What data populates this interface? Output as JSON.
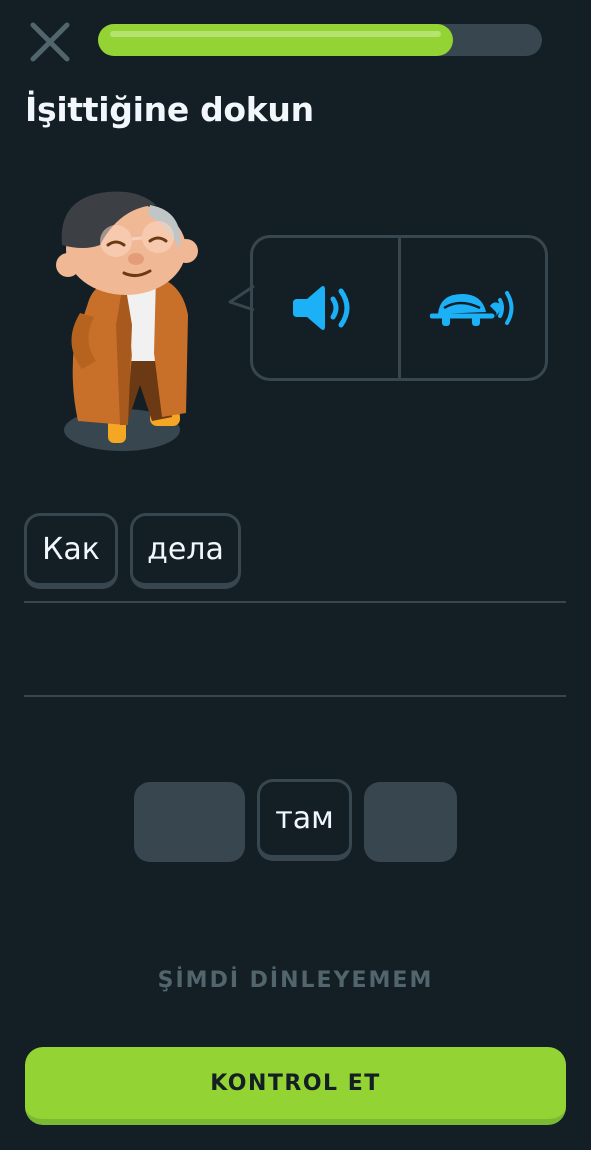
{
  "header": {
    "close_icon": "close-icon",
    "progress": 0.8
  },
  "prompt": {
    "title": "İşittiğine dokun"
  },
  "audio": {
    "normal_icon": "speaker-icon",
    "slow_icon": "turtle-speaker-icon"
  },
  "answer": {
    "selected_words": [
      "Как",
      "дела"
    ]
  },
  "word_bank": {
    "tiles": [
      {
        "label": "",
        "used": true
      },
      {
        "label": "там",
        "used": false
      },
      {
        "label": "",
        "used": true
      }
    ]
  },
  "actions": {
    "cant_listen_label": "ŞİMDİ DİNLEYEMEM",
    "check_label": "KONTROL ET"
  },
  "colors": {
    "background": "#131f24",
    "accent_green": "#93d333",
    "audio_blue": "#1cb0f6",
    "border": "#37464f"
  }
}
